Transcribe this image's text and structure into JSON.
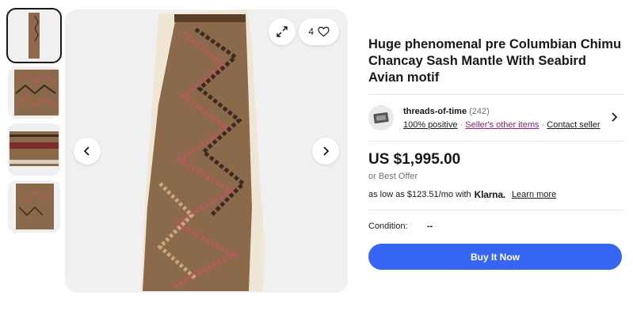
{
  "gallery": {
    "thumbnail_count": 4,
    "active_index": 0,
    "watch_count": "4"
  },
  "icons": {
    "prev": "chevron-left-icon",
    "next": "chevron-right-icon",
    "expand": "expand-icon",
    "heart": "heart-icon",
    "seller_chevron": "chevron-right-icon"
  },
  "listing": {
    "title": "Huge phenomenal pre Columbian Chimu Chancay Sash Mantle With Seabird Avian motif",
    "price": "US $1,995.00",
    "best_offer": "or Best Offer",
    "klarna_prefix": "as low as $123.51/mo with",
    "klarna_brand": "Klarna.",
    "learn_more": "Learn more",
    "condition_label": "Condition:",
    "condition_value": "--",
    "buy_button": "Buy It Now"
  },
  "seller": {
    "name": "threads-of-time",
    "feedback_count": "(242)",
    "positive": "100% positive",
    "separator": "·",
    "other_items": "Seller's other items",
    "contact": "Contact seller"
  },
  "colors": {
    "buy_button": "#3665f3",
    "link_purple": "#8b1f7f",
    "textile_base": "#8a6a4a",
    "textile_zigzag_red": "#b55a5a",
    "textile_zigzag_dark": "#3a2a20"
  }
}
